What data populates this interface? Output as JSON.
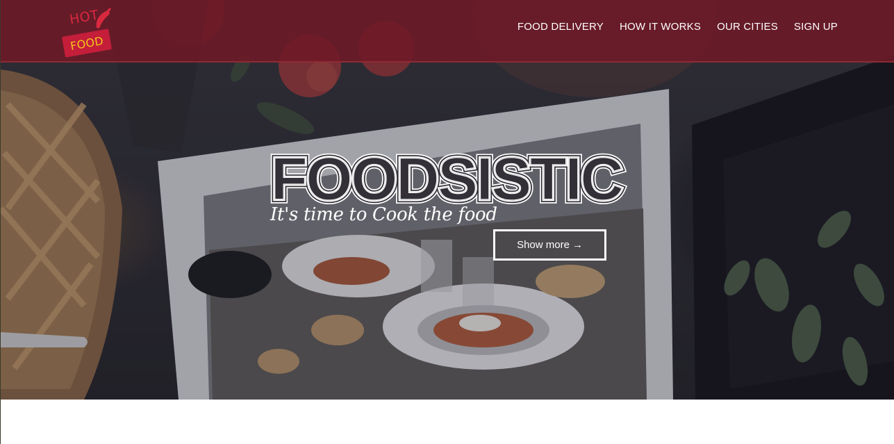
{
  "header": {
    "logo": {
      "top_text": "HOT",
      "tag_text": "FOOD",
      "icon": "chili-pepper-icon"
    },
    "nav": [
      {
        "label": "FOOD DELIVERY"
      },
      {
        "label": "HOW IT WORKS"
      },
      {
        "label": "OUR CITIES"
      },
      {
        "label": "SIGN UP"
      }
    ]
  },
  "hero": {
    "title": "FOODSISTIC",
    "tagline": "It's time to Cook the food",
    "cta": {
      "label": "Show more",
      "icon": "arrow-right-icon",
      "glyph": "→"
    }
  },
  "colors": {
    "header_bg": "#701826",
    "logo_red": "#c41e3a",
    "logo_yellow": "#f4c21b",
    "text": "#ffffff"
  }
}
